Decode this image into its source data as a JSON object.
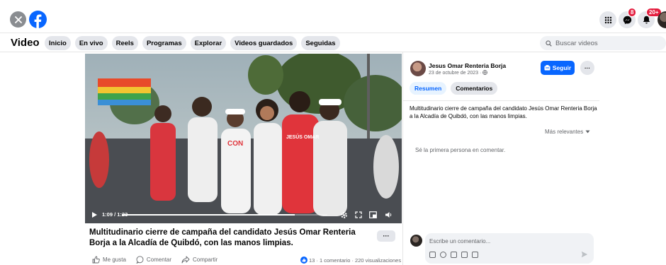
{
  "nav": {
    "title": "Video",
    "tabs": [
      "Inicio",
      "En vivo",
      "Reels",
      "Programas",
      "Explorar",
      "Videos guardados",
      "Seguidas"
    ],
    "search_placeholder": "Buscar videos"
  },
  "header": {
    "messenger_badge": "8",
    "notifications_badge": "20+"
  },
  "video": {
    "time": "1:09 / 1:23",
    "progress": 0.84,
    "people_shirt_texts": [
      "CON",
      "JESÚS OMAR"
    ]
  },
  "post": {
    "title": "Multitudinario cierre de campaña del candidato Jesús Omar Renteria Borja a la Alcadía de Quibdó, con las manos limpias.",
    "more_label": "···",
    "actions": {
      "like": "Me gusta",
      "comment": "Comentar",
      "share": "Compartir"
    },
    "stats": "13 · 1 comentario · 220 visualizaciones"
  },
  "sidebar": {
    "author": "Jesus Omar Renteria Borja",
    "date": "23 de octubre de 2023 ·",
    "follow_label": "Seguir",
    "dots_label": "···",
    "tabs": {
      "summary": "Resumen",
      "comments": "Comentarios"
    },
    "description": "Multitudinario cierre de campaña del candidato Jesús Omar Renteria Borja a la Alcadía de Quibdó, con las manos limpias.",
    "sort_label": "Más relevantes",
    "empty_comments": "Sé la primera persona en comentar.",
    "comment_placeholder": "Escribe un comentario..."
  },
  "colors": {
    "brand": "#0866ff",
    "badge": "#e41e3f",
    "chip": "#e4e6eb"
  }
}
